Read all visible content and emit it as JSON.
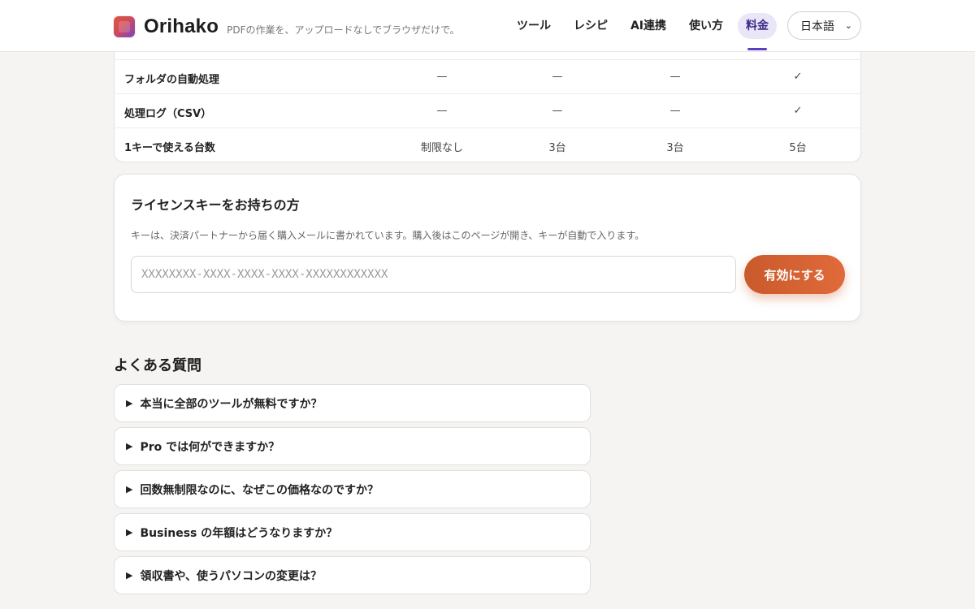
{
  "header": {
    "brand": "Orihako",
    "tagline": "PDFの作業を、アップロードなしでブラウザだけで。",
    "nav": [
      "ツール",
      "レシピ",
      "AI連携",
      "使い方",
      "料金"
    ],
    "active_nav": "料金",
    "language": "日本語"
  },
  "table": {
    "rows": [
      {
        "label": "フォルダの自動処理",
        "cells": [
          "—",
          "—",
          "—",
          "✓"
        ]
      },
      {
        "label": "処理ログ（CSV）",
        "cells": [
          "—",
          "—",
          "—",
          "✓"
        ]
      },
      {
        "label": "1キーで使える台数",
        "cells": [
          "制限なし",
          "3台",
          "3台",
          "5台"
        ]
      }
    ]
  },
  "license": {
    "title": "ライセンスキーをお持ちの方",
    "description": "キーは、決済パートナーから届く購入メールに書かれています。購入後はこのページが開き、キーが自動で入ります。",
    "placeholder": "XXXXXXXX-XXXX-XXXX-XXXX-XXXXXXXXXXXX",
    "button": "有効にする"
  },
  "faq": {
    "title": "よくある質問",
    "items": [
      "本当に全部のツールが無料ですか？",
      "Pro では何ができますか？",
      "回数無制限なのに、なぜこの価格なのですか？",
      "Business の年額はどうなりますか？",
      "領収書や、使うパソコンの変更は？"
    ]
  },
  "colors": {
    "accent_purple": "#5b3fc4",
    "button_orange": "#d9623a",
    "check_green": "#3c8f54"
  }
}
